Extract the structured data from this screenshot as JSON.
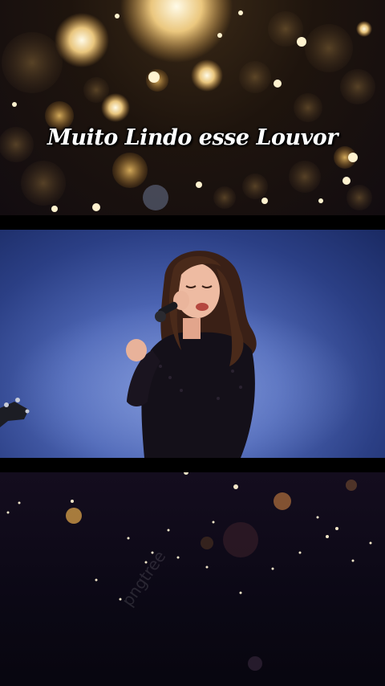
{
  "caption": {
    "text": "Muito Lindo esse Louvor"
  },
  "emojis": [
    {
      "icon": "loudly-crying-face-icon"
    },
    {
      "icon": "red-heart-icon"
    }
  ],
  "watermark": {
    "text": "pngtree"
  },
  "colors": {
    "stage_blue": "#4e67b6",
    "bokeh_gold": "#e8b04a"
  }
}
